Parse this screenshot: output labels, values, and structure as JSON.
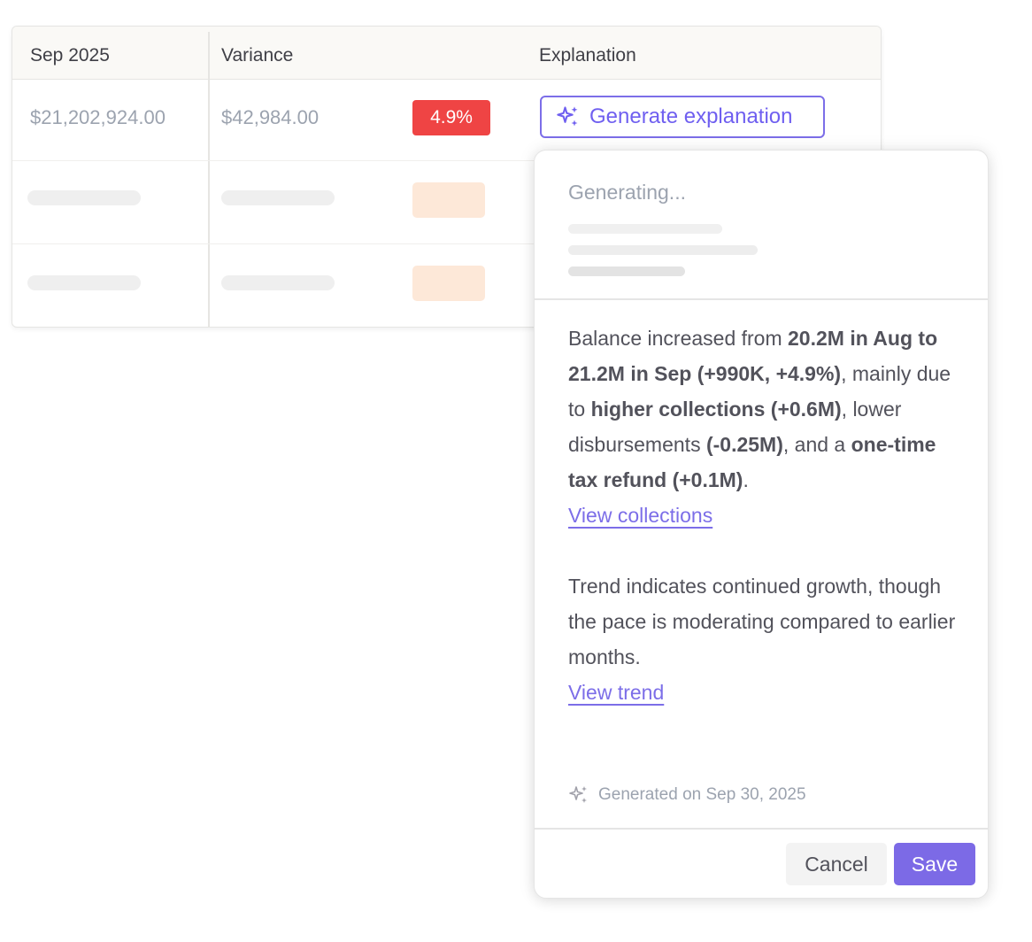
{
  "table": {
    "headers": [
      "Sep 2025",
      "Variance",
      "Explanation"
    ],
    "row1": {
      "sep_value": "$21,202,924.00",
      "variance_value": "$42,984.00",
      "variance_pct": "4.9%",
      "generate_label": "Generate explanation"
    }
  },
  "popover": {
    "status": "Generating...",
    "explanation": {
      "p1_a": "Balance increased from ",
      "p1_b": "20.2M in Aug to 21.2M in Sep (+990K, +4.9%)",
      "p1_c": ", mainly due to ",
      "p1_d": "higher collections (+0.6M)",
      "p1_e": ", lower disbursements ",
      "p1_f": "(-0.25M)",
      "p1_g": ", and a ",
      "p1_h": "one-time tax refund (+0.1M)",
      "p1_i": ".",
      "link1": "View collections",
      "p2": "Trend indicates continued growth, though the pace is moderating compared to earlier months.",
      "link2": "View trend"
    },
    "generated_on": "Generated on Sep 30, 2025",
    "cancel_label": "Cancel",
    "save_label": "Save"
  },
  "colors": {
    "accent": "#7c6ee8",
    "danger": "#ef4444",
    "skeleton": "#efefef",
    "skeleton_warm": "#fde8d8"
  },
  "icons": [
    "sparkle-icon"
  ]
}
